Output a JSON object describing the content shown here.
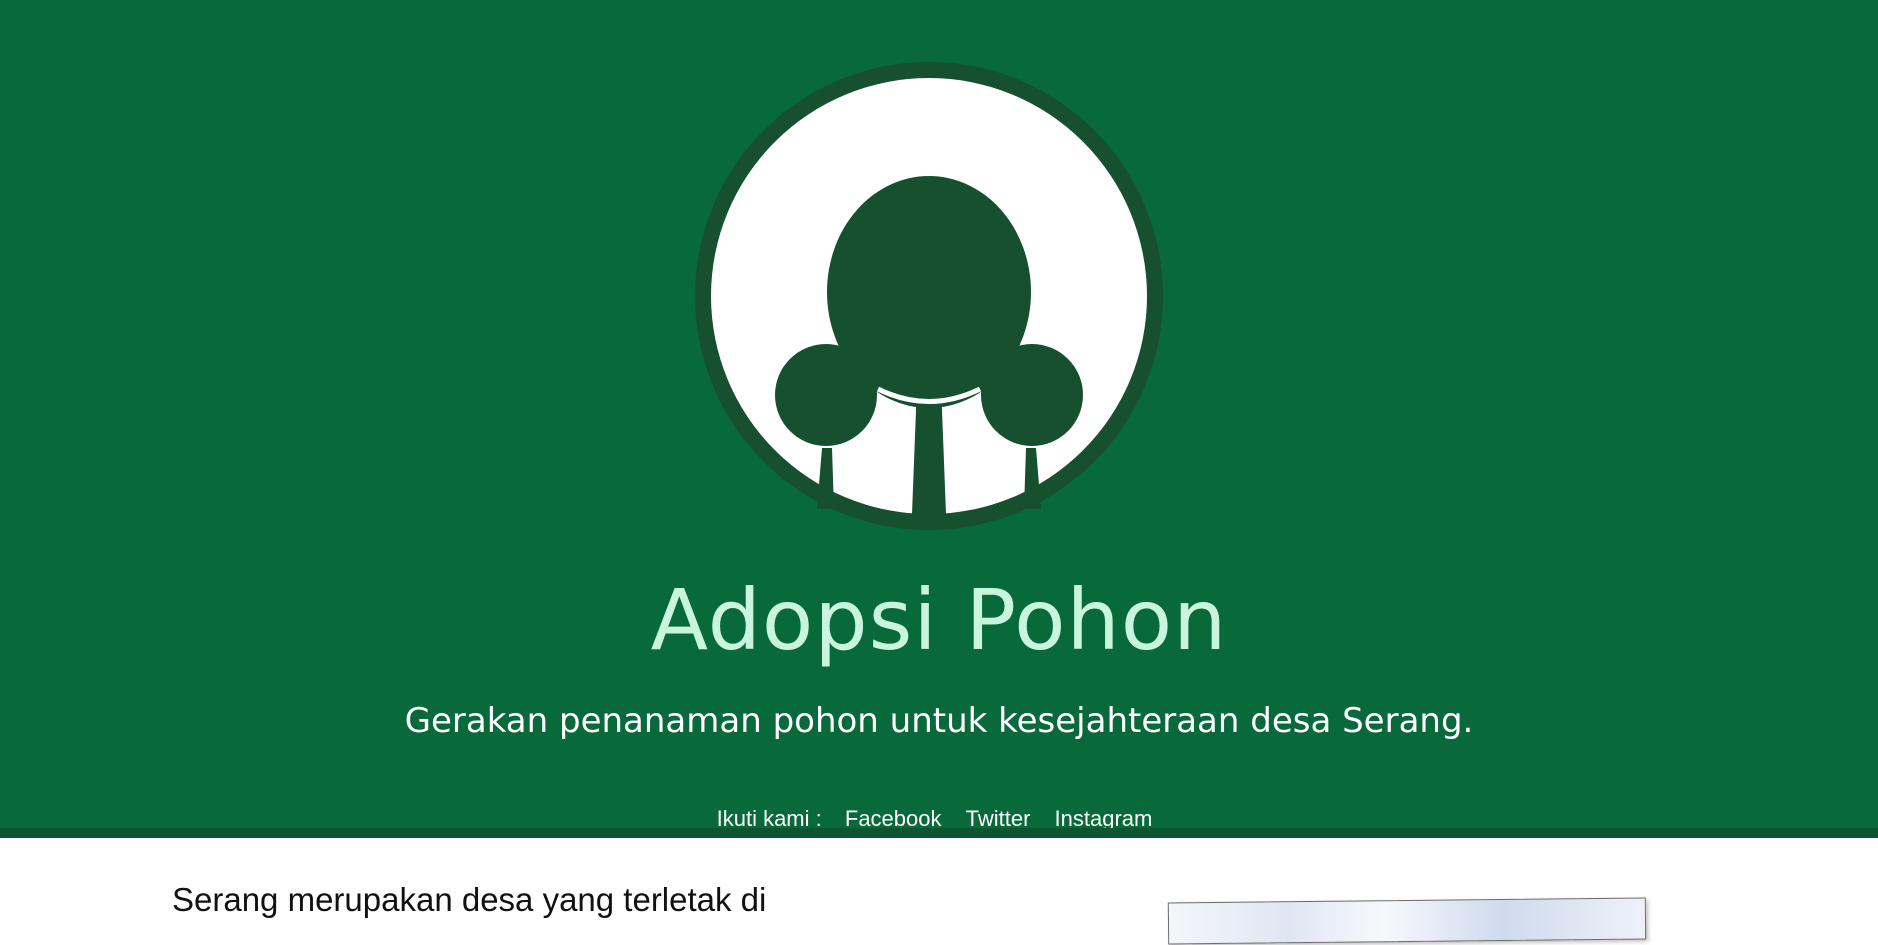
{
  "hero": {
    "title": "Adopsi Pohon",
    "tagline": "Gerakan penanaman pohon untuk kesejahteraan desa Serang.",
    "background_color": "#08693a",
    "title_color": "#c8f5dc",
    "logo_icon": "tree-icon",
    "logo_color": "#16502f"
  },
  "social": {
    "label": "Ikuti kami :",
    "links": [
      "Facebook",
      "Twitter",
      "Instagram"
    ]
  },
  "content": {
    "intro_text": "Serang merupakan desa yang terletak di"
  }
}
